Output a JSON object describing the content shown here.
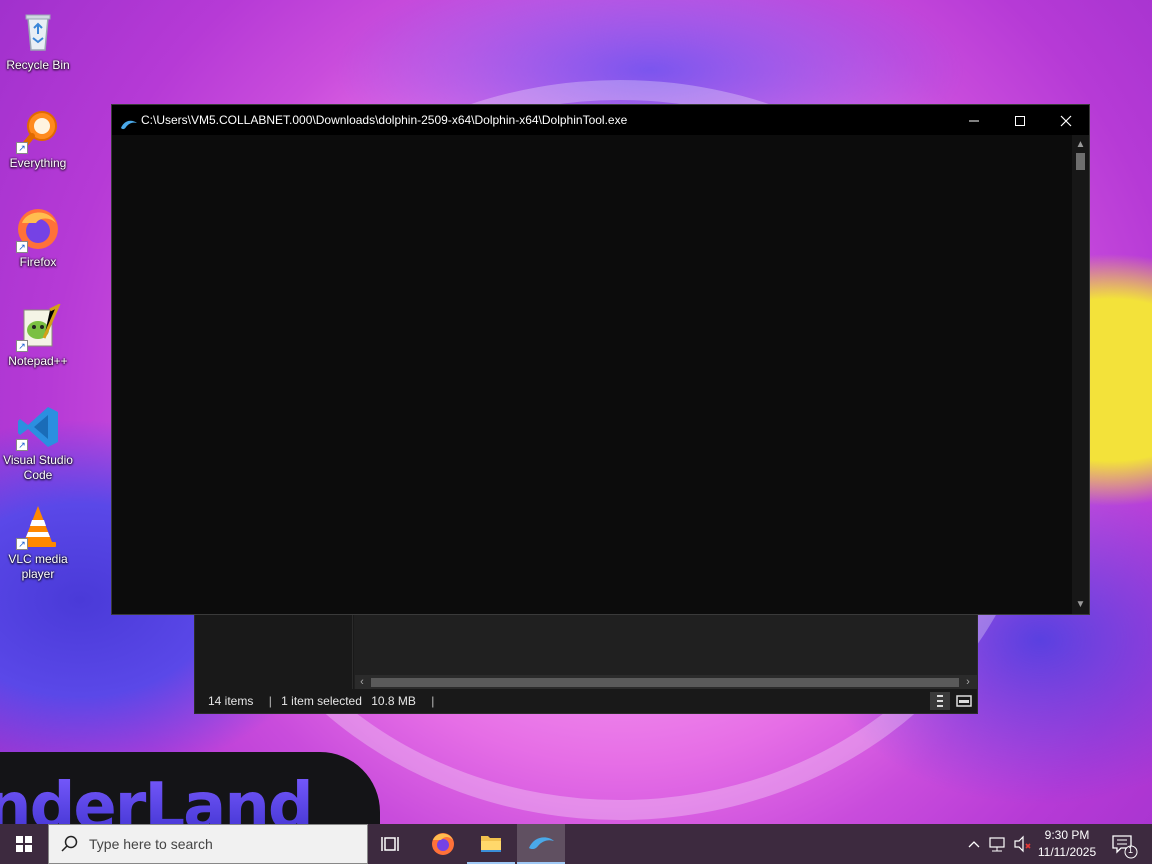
{
  "desktop": {
    "icons": [
      {
        "label": "Recycle Bin",
        "icon": "recycle-bin-icon"
      },
      {
        "label": "Everything",
        "icon": "everything-search-icon"
      },
      {
        "label": "Firefox",
        "icon": "firefox-icon"
      },
      {
        "label": "Notepad++",
        "icon": "notepad-plus-plus-icon"
      },
      {
        "label": "Visual Studio Code",
        "icon": "vscode-icon"
      },
      {
        "label": "VLC media player",
        "icon": "vlc-icon"
      }
    ],
    "wallpaper_text": "nderLand"
  },
  "console_window": {
    "title": "C:\\Users\\VM5.COLLABNET.000\\Downloads\\dolphin-2509-x64\\Dolphin-x64\\DolphinTool.exe",
    "minimize": "—",
    "maximize": "☐",
    "close": "✕"
  },
  "explorer_window": {
    "status": {
      "items": "14 items",
      "selected": "1 item selected",
      "size": "10.8 MB"
    }
  },
  "taskbar": {
    "search_placeholder": "Type here to search",
    "apps": [
      "task-view",
      "firefox",
      "file-explorer",
      "dolphin"
    ],
    "clock": {
      "time": "9:30 PM",
      "date": "11/11/2025"
    },
    "notification_count": "1"
  },
  "colors": {
    "console_bg": "#0c0c0c",
    "taskbar_bg": "#3d2a3f",
    "accent": "#1e90ff"
  }
}
